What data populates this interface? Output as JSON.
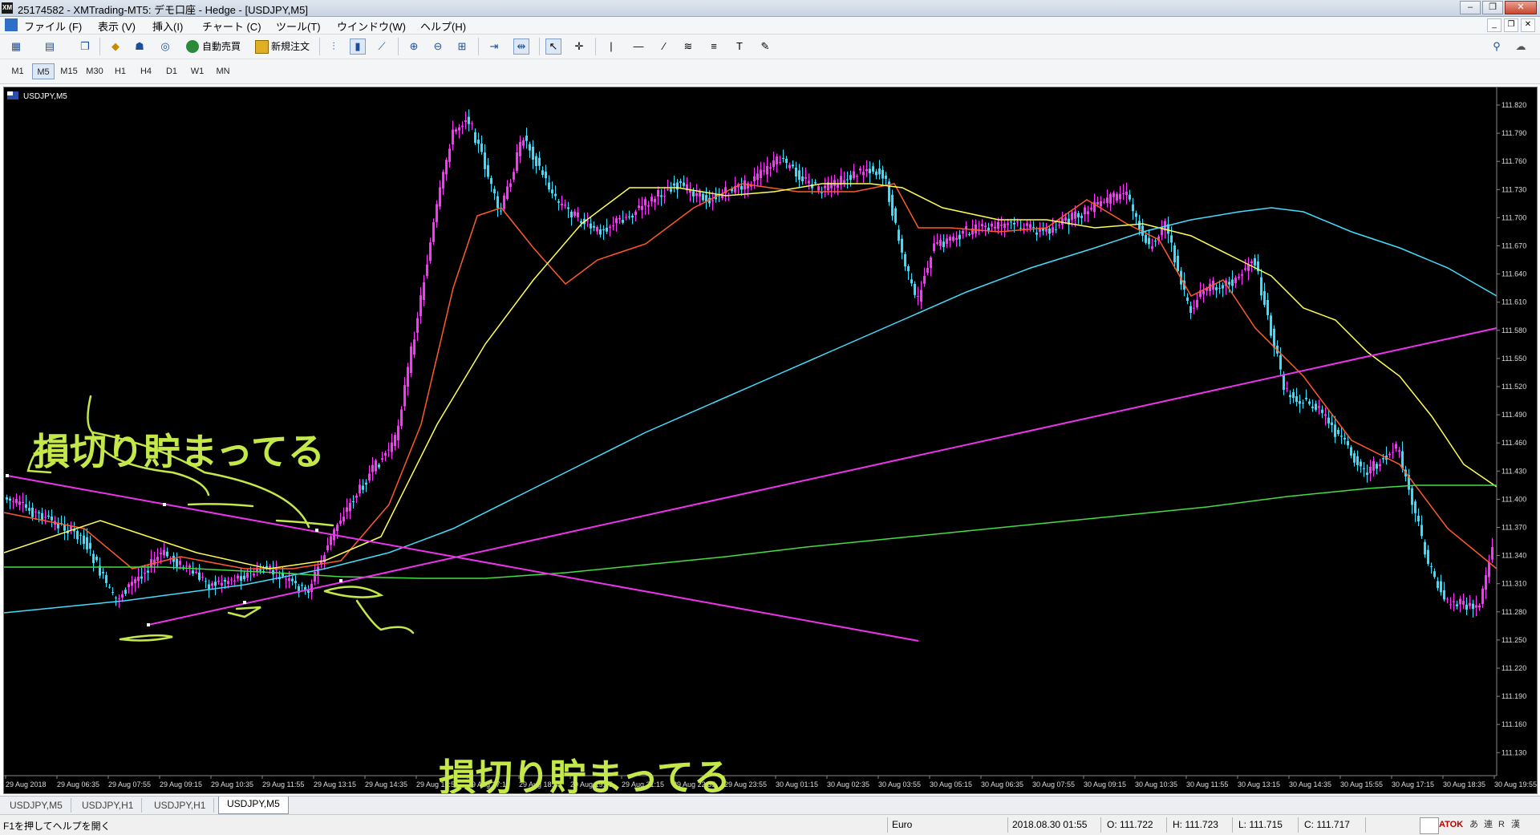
{
  "window": {
    "title": "25174582 - XMTrading-MT5: デモ口座 - Hedge - [USDJPY,M5]",
    "app_icon_text": "XM",
    "buttons": [
      "–",
      "❐",
      "✕"
    ]
  },
  "menu": {
    "items": [
      "ファイル (F)",
      "表示 (V)",
      "挿入(I)",
      "チャート (C)",
      "ツール(T)",
      "ウインドウ(W)",
      "ヘルプ(H)"
    ],
    "mdi_buttons": [
      "_",
      "❐",
      "✕"
    ]
  },
  "toolbar": {
    "auto_trade_label": "自動売買",
    "new_order_label": "新規注文",
    "icons": [
      "new-chart-icon",
      "profiles-icon",
      "market-watch-icon",
      "navigator-icon",
      "data-window-icon",
      "signals-icon",
      "bar-chart-icon",
      "candle-chart-icon",
      "line-chart-icon",
      "zoom-in-icon",
      "zoom-out-icon",
      "tile-windows-icon",
      "autoscroll-icon",
      "chart-shift-icon",
      "cursor-icon",
      "crosshair-icon",
      "vertical-line-icon",
      "horizontal-line-icon",
      "trendline-icon",
      "fibonacci-icon",
      "channel-icon",
      "text-icon",
      "shapes-icon",
      "search-icon",
      "chat-icon"
    ]
  },
  "timeframes": {
    "items": [
      "M1",
      "M5",
      "M15",
      "M30",
      "H1",
      "H4",
      "D1",
      "W1",
      "MN"
    ],
    "active": "M5"
  },
  "chart": {
    "symbol_label": "USDJPY,M5",
    "price_labels": [
      "111.820",
      "111.790",
      "111.760",
      "111.730",
      "111.700",
      "111.670",
      "111.640",
      "111.610",
      "111.580",
      "111.550",
      "111.520",
      "111.490",
      "111.460",
      "111.430",
      "111.400",
      "111.370",
      "111.340",
      "111.310",
      "111.280",
      "111.250",
      "111.220",
      "111.190",
      "111.160",
      "111.130"
    ],
    "time_labels": [
      "29 Aug 2018",
      "29 Aug 06:35",
      "29 Aug 07:55",
      "29 Aug 09:15",
      "29 Aug 10:35",
      "29 Aug 11:55",
      "29 Aug 13:15",
      "29 Aug 14:35",
      "29 Aug 15:55",
      "29 Aug 17:15",
      "29 Aug 18:35",
      "29 Aug 19:55",
      "29 Aug 21:15",
      "29 Aug 22:35",
      "29 Aug 23:55",
      "30 Aug 01:15",
      "30 Aug 02:35",
      "30 Aug 03:55",
      "30 Aug 05:15",
      "30 Aug 06:35",
      "30 Aug 07:55",
      "30 Aug 09:15",
      "30 Aug 10:35",
      "30 Aug 11:55",
      "30 Aug 13:15",
      "30 Aug 14:35",
      "30 Aug 15:55",
      "30 Aug 17:15",
      "30 Aug 18:35",
      "30 Aug 19:55"
    ],
    "annotation_text": "損切り貯まってる",
    "colors": {
      "bull": "#ff33ff",
      "bear": "#33e0ff",
      "ma_fast": "#ff5a2a",
      "ma_mid": "#ffff55",
      "ma_slow": "#44ddff",
      "ma_long": "#44dd44",
      "trendline": "#ee33ee",
      "annotation": "#c4e84a"
    }
  },
  "tabs": {
    "items": [
      "USDJPY,M5",
      "USDJPY,H1",
      "USDJPY,H1",
      "USDJPY,M5"
    ],
    "active_index": 3
  },
  "status": {
    "help": "F1を押してヘルプを開く",
    "profile": "Euro",
    "datetime": "2018.08.30 01:55",
    "open": "O: 111.722",
    "high": "H: 111.723",
    "low": "L: 111.715",
    "close": "C: 111.717",
    "ime": [
      "ATOK",
      "あ",
      "連",
      "R",
      "漢"
    ]
  }
}
